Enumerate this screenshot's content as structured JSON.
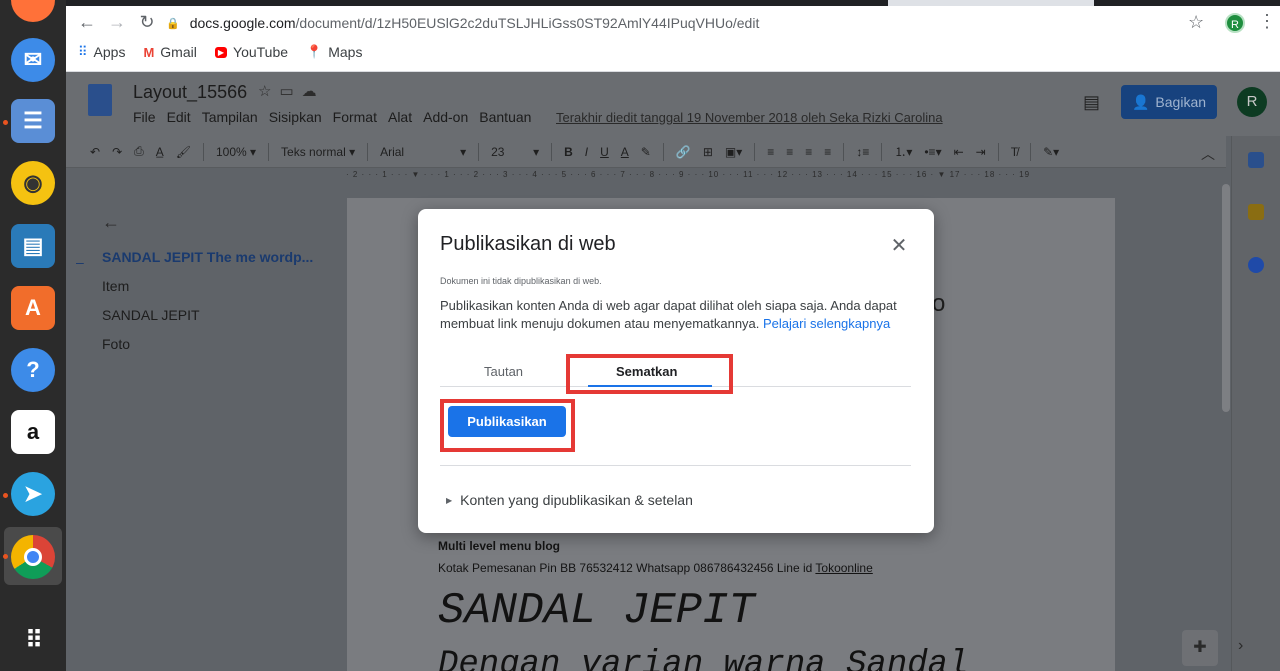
{
  "browser": {
    "url_host": "docs.google.com",
    "url_path": "/document/d/1zH50EUSlG2c2duTSLJHLiGss0ST92AmlY44IPuqVHUo/edit",
    "profile_initial": "R",
    "bookmarks": [
      {
        "label": "Apps",
        "icon": "apps-grid-icon"
      },
      {
        "label": "Gmail",
        "icon": "gmail-icon"
      },
      {
        "label": "YouTube",
        "icon": "youtube-icon"
      },
      {
        "label": "Maps",
        "icon": "maps-pin-icon"
      }
    ]
  },
  "docs": {
    "title": "Layout_15566",
    "menu": [
      "File",
      "Edit",
      "Tampilan",
      "Sisipkan",
      "Format",
      "Alat",
      "Add-on",
      "Bantuan"
    ],
    "last_edit": "Terakhir diedit tanggal 19 November 2018 oleh Seka Rizki Carolina",
    "share_label": "Bagikan",
    "profile_initial": "R",
    "toolbar": {
      "zoom": "100%",
      "style": "Teks normal",
      "font": "Arial",
      "size": "23"
    },
    "ruler_text": "· 2 · · · 1 · · · ▼ · · · 1 · · · 2 · · · 3 · · · 4 · · · 5 · · · 6 · · · 7 · · · 8 · · · 9 · · · 10 · · · 11 · · · 12 · · · 13 · · · 14 · · · 15 · · · 16 · ▼ 17 · · · 18 · · · 19",
    "outline": {
      "items": [
        "SANDAL JEPIT The me wordp...",
        "Item",
        "SANDAL JEPIT",
        "Foto"
      ]
    },
    "page": {
      "partial_letter": "o",
      "bold_line": "Multi level menu blog",
      "text_line": "Kotak Pemesanan Pin BB 76532412 Whatsapp 086786432456 Line id ",
      "text_link": "Tokoonline",
      "heading1": "SANDAL JEPIT",
      "heading2": "Dengan varian warna Sandal"
    }
  },
  "dialog": {
    "title": "Publikasikan di web",
    "status": "Dokumen ini tidak dipublikasikan di web.",
    "description": "Publikasikan konten Anda di web agar dapat dilihat oleh siapa saja. Anda dapat membuat link menuju dokumen atau menyematkannya. ",
    "learn_more": "Pelajari selengkapnya",
    "tabs": [
      "Tautan",
      "Sematkan"
    ],
    "active_tab": "Sematkan",
    "publish_button": "Publikasikan",
    "expander_label": "Konten yang dipublikasikan & setelan",
    "highlight_color": "#e53935",
    "accent_color": "#1a73e8"
  },
  "dock": {
    "icons": [
      "firefox-icon",
      "thunderbird-icon",
      "files-icon",
      "rhythmbox-icon",
      "libreoffice-writer-icon",
      "ubuntu-software-icon",
      "help-icon",
      "amazon-icon",
      "telegram-icon",
      "chrome-icon",
      "show-apps-icon"
    ]
  }
}
